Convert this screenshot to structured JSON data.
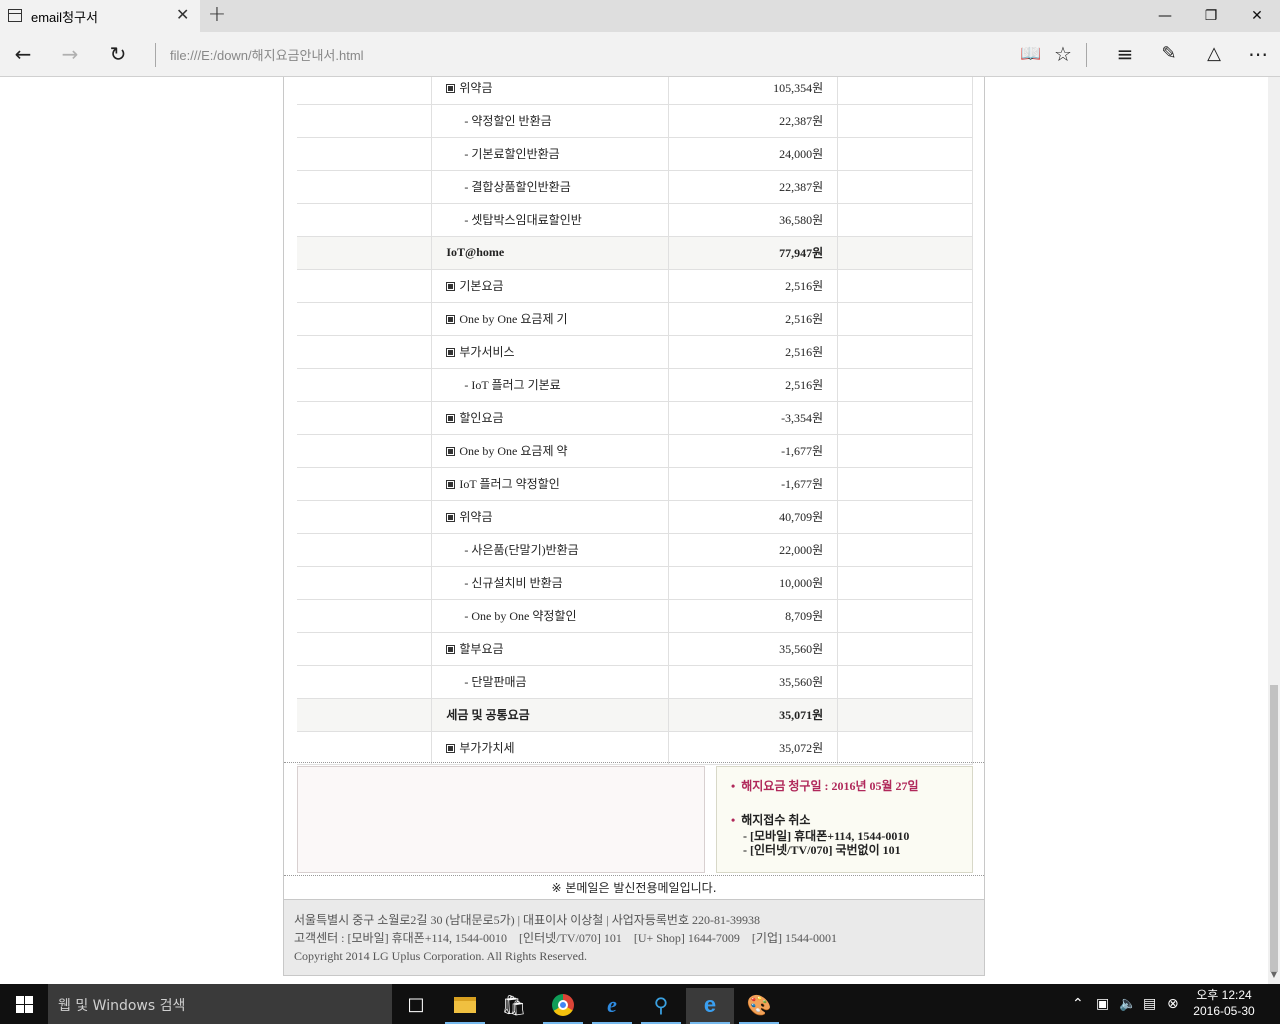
{
  "browser": {
    "tab_title": "email청구서",
    "address": "file:///E:/down/해지요금안내서.html"
  },
  "icons": {
    "tab": "page-icon",
    "tab_close": "close-icon",
    "new_tab": "plus-icon",
    "minimize": "minimize-icon",
    "restore": "restore-icon",
    "close": "close-icon",
    "back": "back-arrow-icon",
    "forward": "forward-arrow-icon",
    "refresh": "refresh-icon",
    "reading": "reading-view-icon",
    "favorite": "star-icon",
    "hub": "hub-icon",
    "note": "web-note-icon",
    "share": "share-icon",
    "more": "more-icon"
  },
  "bill_rows": [
    {
      "type": "item",
      "label": "위약금",
      "amount": "105,354원"
    },
    {
      "type": "sub",
      "label": "- 약정할인 반환금",
      "amount": "22,387원"
    },
    {
      "type": "sub",
      "label": "- 기본료할인반환금",
      "amount": "24,000원"
    },
    {
      "type": "sub",
      "label": "- 결합상품할인반환금",
      "amount": "22,387원"
    },
    {
      "type": "sub",
      "label": "- 셋탑박스임대료할인반",
      "amount": "36,580원"
    },
    {
      "type": "section",
      "label": "IoT@home",
      "amount": "77,947원"
    },
    {
      "type": "item",
      "label": "기본요금",
      "amount": "2,516원"
    },
    {
      "type": "item",
      "label": "One by One 요금제 기",
      "amount": "2,516원"
    },
    {
      "type": "item",
      "label": "부가서비스",
      "amount": "2,516원"
    },
    {
      "type": "sub",
      "label": "- IoT 플러그 기본료",
      "amount": "2,516원"
    },
    {
      "type": "item",
      "label": "할인요금",
      "amount": "-3,354원"
    },
    {
      "type": "item",
      "label": "One by One 요금제 약",
      "amount": "-1,677원"
    },
    {
      "type": "item",
      "label": "IoT 플러그 약정할인",
      "amount": "-1,677원"
    },
    {
      "type": "item",
      "label": "위약금",
      "amount": "40,709원"
    },
    {
      "type": "sub",
      "label": "- 사은품(단말기)반환금",
      "amount": "22,000원"
    },
    {
      "type": "sub",
      "label": "- 신규설치비 반환금",
      "amount": "10,000원"
    },
    {
      "type": "sub",
      "label": "- One by One 약정할인",
      "amount": "8,709원"
    },
    {
      "type": "item",
      "label": "할부요금",
      "amount": "35,560원"
    },
    {
      "type": "sub",
      "label": "- 단말판매금",
      "amount": "35,560원"
    },
    {
      "type": "section",
      "label": "세금 및 공통요금",
      "amount": "35,071원"
    },
    {
      "type": "item",
      "label": "부가가치세",
      "amount": "35,072원"
    }
  ],
  "notice": {
    "bullet": "•",
    "claim_date": "해지요금 청구일 : 2016년 05월 27일",
    "cancel_title": "해지접수 취소",
    "mobile": "- [모바일] 휴대폰+114, 1544-0010",
    "internet": "- [인터넷/TV/070] 국번없이 101"
  },
  "mail_only": "※ 본메일은 발신전용메일입니다.",
  "footer": {
    "address": "서울특별시 중구 소월로2길 30 (남대문로5가) | 대표이사 이상철 | 사업자등록번호 220-81-39938",
    "contact": "고객센터 : [모바일] 휴대폰+114, 1544-0010    [인터넷/TV/070] 101    [U+ Shop] 1644-7009    [기업] 1544-0001",
    "copyright": "Copyright 2014 LG Uplus Corporation. All Rights Reserved."
  },
  "taskbar": {
    "search_placeholder": "웹 및 Windows 검색",
    "time": "오후 12:24",
    "date": "2016-05-30",
    "apps": [
      "task-view-icon",
      "file-explorer-icon",
      "store-icon",
      "chrome-icon",
      "internet-explorer-icon",
      "search-app-icon",
      "edge-icon",
      "paint-icon"
    ]
  }
}
